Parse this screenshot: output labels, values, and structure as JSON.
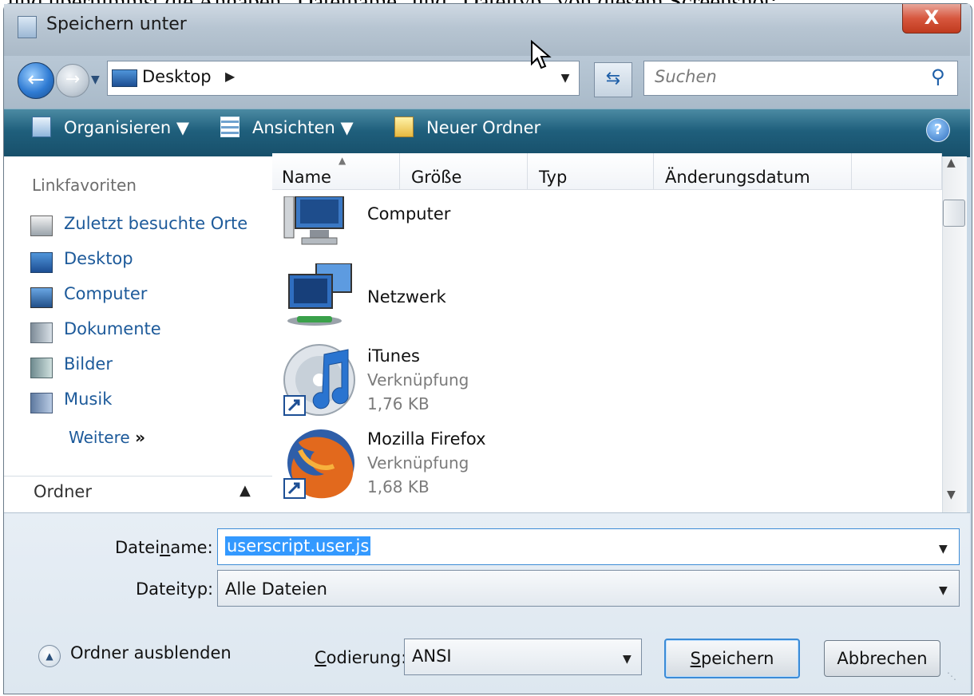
{
  "caption": "und übernimmst die Angaben \"Dateiname\" und \"Dateityp\" von diesem Screenshot:",
  "window": {
    "title": "Speichern unter",
    "close_label": "X"
  },
  "nav": {
    "address": "Desktop",
    "search_placeholder": "Suchen"
  },
  "toolbar": {
    "organize": "Organisieren",
    "views": "Ansichten",
    "new_folder": "Neuer Ordner",
    "help": "?"
  },
  "sidebar": {
    "heading": "Linkfavoriten",
    "items": [
      {
        "label": "Zuletzt besuchte Orte",
        "icon": "recent-places-icon"
      },
      {
        "label": "Desktop",
        "icon": "desktop-icon"
      },
      {
        "label": "Computer",
        "icon": "computer-icon"
      },
      {
        "label": "Dokumente",
        "icon": "documents-icon"
      },
      {
        "label": "Bilder",
        "icon": "pictures-icon"
      },
      {
        "label": "Musik",
        "icon": "music-icon"
      }
    ],
    "more": "Weitere",
    "folders": "Ordner"
  },
  "columns": [
    "Name",
    "Größe",
    "Typ",
    "Änderungsdatum"
  ],
  "files": [
    {
      "name": "Computer",
      "icon": "computer-icon"
    },
    {
      "name": "Netzwerk",
      "icon": "network-icon"
    },
    {
      "name": "iTunes",
      "type": "Verknüpfung",
      "size": "1,76 KB",
      "icon": "itunes-icon"
    },
    {
      "name": "Mozilla Firefox",
      "type": "Verknüpfung",
      "size": "1,68 KB",
      "icon": "firefox-icon"
    }
  ],
  "form": {
    "filename_label_pre": "Datei",
    "filename_label_u": "n",
    "filename_label_post": "ame:",
    "filename_value": "userscript.user.js",
    "filetype_label": "Dateityp:",
    "filetype_value": "Alle Dateien",
    "encoding_label_u": "C",
    "encoding_label_post": "odierung:",
    "encoding_value": "ANSI",
    "hide_folders": "Ordner ausblenden",
    "save_u": "S",
    "save_post": "peichern",
    "cancel": "Abbrechen"
  }
}
